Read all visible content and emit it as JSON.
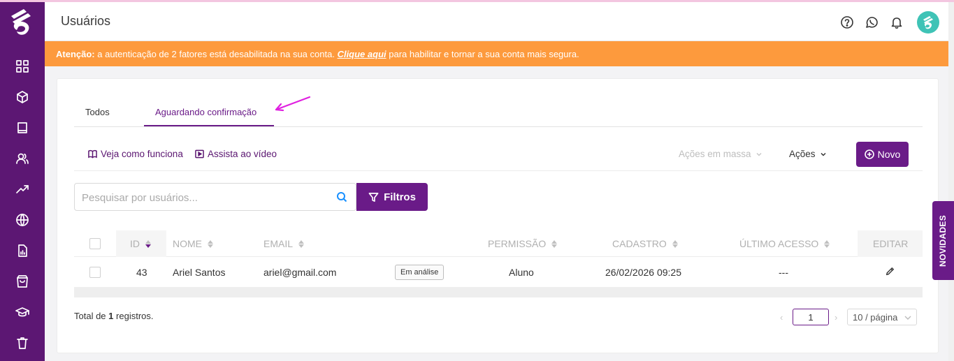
{
  "header": {
    "title": "Usuários"
  },
  "alert": {
    "prefix": "Atenção:",
    "message": "a autenticação de 2 fatores está desabilitada na sua conta.",
    "link": "Clique aqui",
    "suffix": "para habilitar e tornar a sua conta mais segura."
  },
  "sidebar": {
    "icons": [
      "dashboard-icon",
      "cube-icon",
      "book-icon",
      "users-icon",
      "trending-icon",
      "globe-icon",
      "report-icon",
      "bag-icon",
      "graduation-cap-icon",
      "trash-icon"
    ]
  },
  "tabs": [
    {
      "label": "Todos",
      "active": false
    },
    {
      "label": "Aguardando confirmação",
      "active": true
    }
  ],
  "toolbar": {
    "how_it_works": "Veja como funciona",
    "watch_video": "Assista ao vídeo",
    "bulk_actions": "Ações em massa",
    "actions": "Ações",
    "new_button": "Novo"
  },
  "search": {
    "placeholder": "Pesquisar por usuários...",
    "value": ""
  },
  "filters_button": "Filtros",
  "table": {
    "columns": [
      "ID",
      "NOME",
      "EMAIL",
      "PERMISSÃO",
      "CADASTRO",
      "ÚLTIMO ACESSO",
      "EDITAR"
    ],
    "rows": [
      {
        "id": "43",
        "name": "Ariel Santos",
        "email": "ariel@gmail.com",
        "status": "Em análise",
        "permission": "Aluno",
        "registered": "26/02/2026 09:25",
        "last_access": "---"
      }
    ]
  },
  "footer": {
    "total_prefix": "Total de",
    "total_count": "1",
    "total_suffix": "registros.",
    "current_page": "1",
    "page_size": "10 / página"
  },
  "side_tab": "NOVIDADES",
  "colors": {
    "brand": "#6a1b88",
    "sidebar": "#5c1773",
    "alert": "#fd9a3d",
    "avatar": "#3fc3b6",
    "annotation_arrow": "#e020e0"
  }
}
